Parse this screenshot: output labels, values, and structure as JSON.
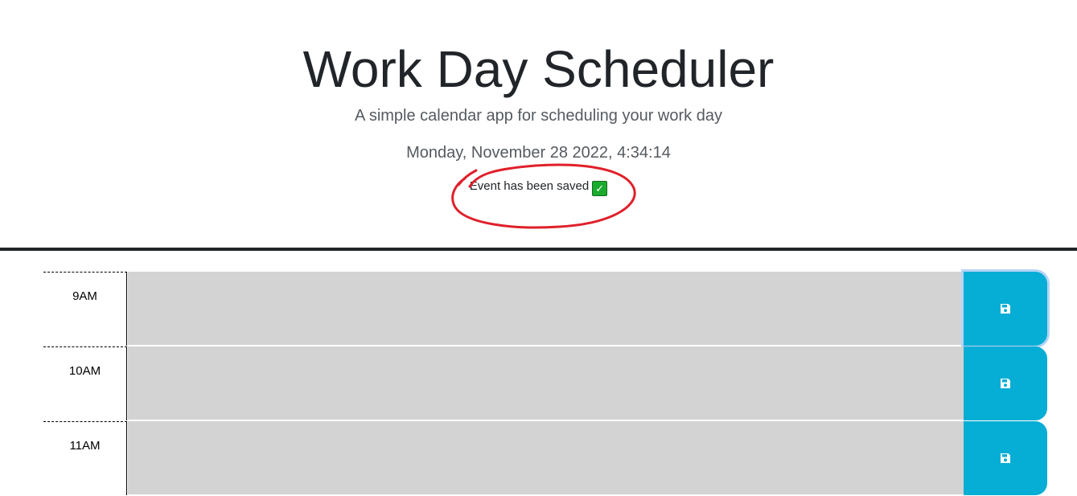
{
  "header": {
    "title": "Work Day Scheduler",
    "subtitle": "A simple calendar app for scheduling your work day",
    "current_day": "Monday, November 28 2022, 4:34:14",
    "saved_message": "Event has been saved",
    "saved_icon": "check-mark-icon"
  },
  "colors": {
    "past": "#d3d3d3",
    "save_button": "#06aed5",
    "annotation": "#e0202a"
  },
  "time_blocks": [
    {
      "hour": "9AM",
      "event": "",
      "save_icon": "floppy-disk-icon"
    },
    {
      "hour": "10AM",
      "event": "",
      "save_icon": "floppy-disk-icon"
    },
    {
      "hour": "11AM",
      "event": "",
      "save_icon": "floppy-disk-icon"
    }
  ]
}
